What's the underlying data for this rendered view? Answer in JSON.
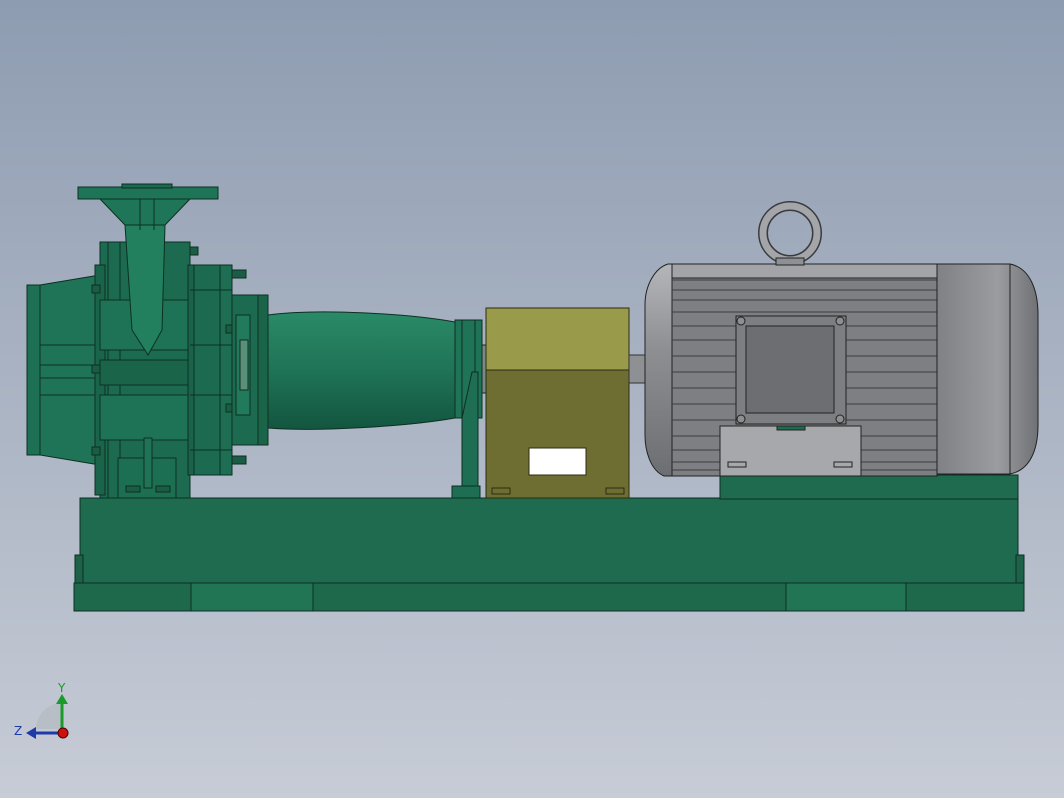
{
  "viewport": {
    "background_top": "#8f9db2",
    "background_bottom": "#c9ced8"
  },
  "model": {
    "components": [
      {
        "name": "base-frame",
        "color": "#1f6b4f"
      },
      {
        "name": "pump-casing",
        "color": "#1e7055"
      },
      {
        "name": "bearing-housing",
        "color": "#227a5c"
      },
      {
        "name": "coupling-guard",
        "color": "#8a8a3c"
      },
      {
        "name": "electric-motor",
        "color": "#8c8e91"
      },
      {
        "name": "lifting-eye",
        "color": "#9a9c9f"
      }
    ]
  },
  "triad": {
    "y_label": "Y",
    "z_label": "Z",
    "y_color": "#1a9a2a",
    "z_color": "#1d3aa8",
    "x_color": "#cc1111"
  }
}
